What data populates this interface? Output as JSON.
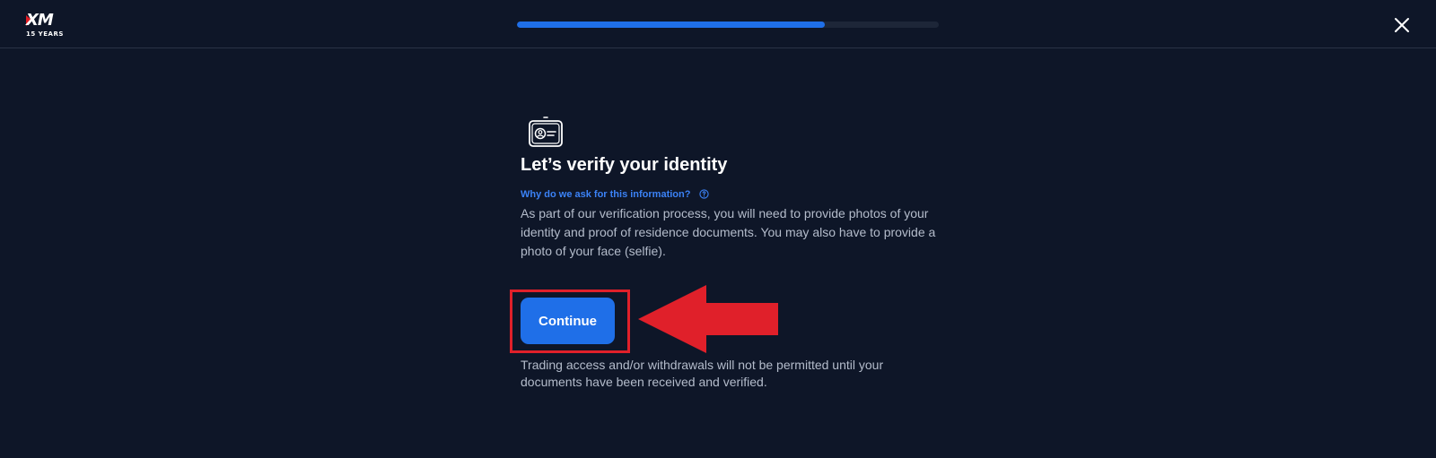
{
  "brand": {
    "logo_text": "XM",
    "logo_subtext": "15 YEARS",
    "accent_color": "#e31b23"
  },
  "header": {
    "progress_fraction": 0.73,
    "progress_color": "#1f6fe8",
    "close_icon": "close-icon"
  },
  "main": {
    "icon": "id-card-icon",
    "title": "Let’s verify your identity",
    "why_link": "Why do we ask for this information?",
    "help_icon": "help-circle-icon",
    "description": "As part of our verification process, you will need to provide photos of your identity and proof of residence documents. You may also have to provide a photo of your face (selfie).",
    "continue_label": "Continue",
    "button_color": "#1f6fe8",
    "notice": "Trading access and/or withdrawals will not be permitted until your documents have been received and verified."
  },
  "annotation": {
    "highlight_color": "#e0202a",
    "arrow_icon": "arrow-left-icon"
  }
}
